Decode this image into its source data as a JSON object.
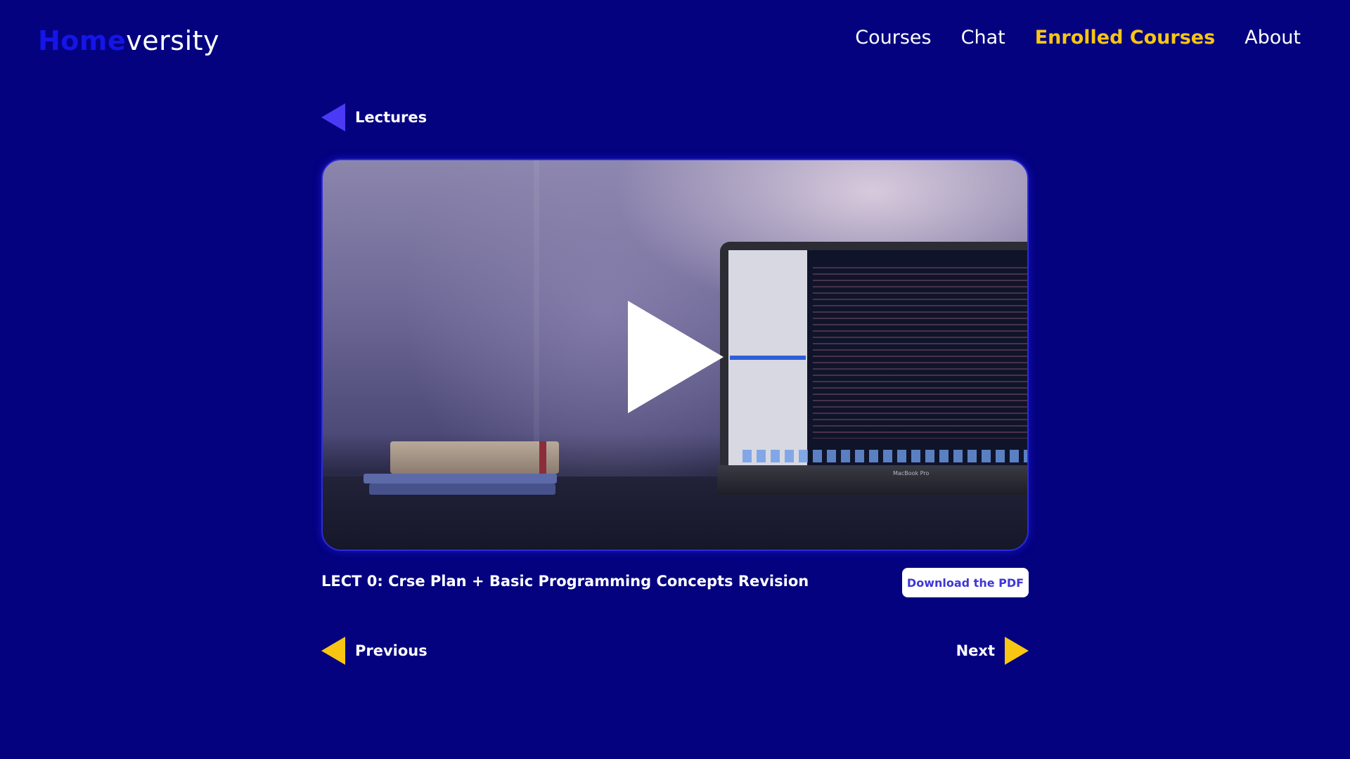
{
  "app": {
    "logo_part1": "Home",
    "logo_part2": "versity"
  },
  "nav": {
    "items": [
      {
        "label": "Courses",
        "active": false
      },
      {
        "label": "Chat",
        "active": false
      },
      {
        "label": "Enrolled Courses",
        "active": true
      },
      {
        "label": "About",
        "active": false
      }
    ]
  },
  "back": {
    "label": "Lectures",
    "icon": "triangle-left-icon"
  },
  "video": {
    "play_icon": "play-icon",
    "thumbnail_laptop_label": "MacBook Pro"
  },
  "lecture": {
    "title": "LECT 0: Crse Plan + Basic Programming Concepts Revision",
    "download_label": "Download the PDF"
  },
  "pagination": {
    "previous_label": "Previous",
    "next_label": "Next"
  },
  "colors": {
    "background": "#04027f",
    "accent_yellow": "#f9c513",
    "accent_purple": "#4b3af5",
    "logo_blue": "#1515e8"
  }
}
